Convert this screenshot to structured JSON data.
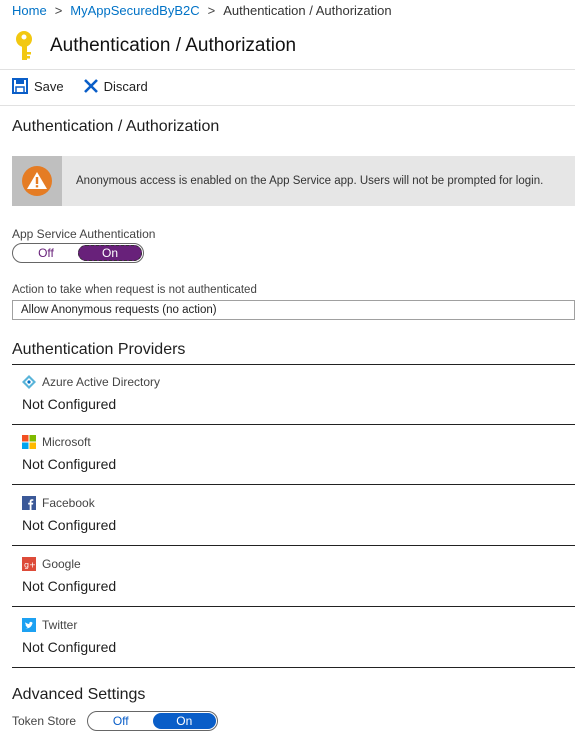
{
  "breadcrumb": [
    "Home",
    "MyAppSecuredByB2C",
    "Authentication / Authorization"
  ],
  "header": {
    "title": "Authentication / Authorization",
    "icon": "key-icon"
  },
  "toolbar": {
    "save_label": "Save",
    "discard_label": "Discard"
  },
  "section_title": "Authentication / Authorization",
  "warning": {
    "icon": "warning-icon",
    "message": "Anonymous access is enabled on the App Service app. Users will not be prompted for login."
  },
  "app_service_auth": {
    "label": "App Service Authentication",
    "off_label": "Off",
    "on_label": "On",
    "selected": "On",
    "accent": "#68217a"
  },
  "action": {
    "label": "Action to take when request is not authenticated",
    "value": "Allow Anonymous requests (no action)"
  },
  "providers": {
    "title": "Authentication Providers",
    "items": [
      {
        "name": "Azure Active Directory",
        "status": "Not Configured",
        "icon": "azure-ad-icon"
      },
      {
        "name": "Microsoft",
        "status": "Not Configured",
        "icon": "microsoft-icon"
      },
      {
        "name": "Facebook",
        "status": "Not Configured",
        "icon": "facebook-icon"
      },
      {
        "name": "Google",
        "status": "Not Configured",
        "icon": "google-icon"
      },
      {
        "name": "Twitter",
        "status": "Not Configured",
        "icon": "twitter-icon"
      }
    ]
  },
  "advanced": {
    "title": "Advanced Settings",
    "token_store_label": "Token Store",
    "off_label": "Off",
    "on_label": "On",
    "selected": "On",
    "accent": "#0a5ec8"
  }
}
